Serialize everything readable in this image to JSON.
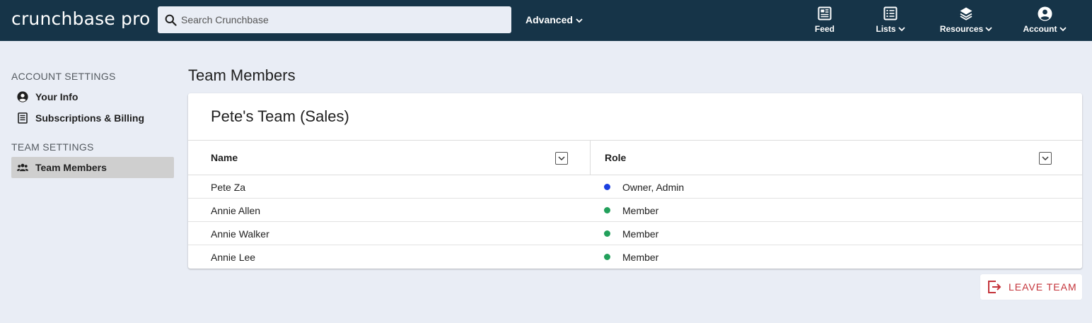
{
  "header": {
    "logo": "crunchbase pro",
    "search_placeholder": "Search Crunchbase",
    "advanced_label": "Advanced",
    "nav": {
      "feed": "Feed",
      "lists": "Lists",
      "resources": "Resources",
      "account": "Account"
    }
  },
  "sidebar": {
    "account_heading": "ACCOUNT SETTINGS",
    "your_info": "Your Info",
    "subscriptions": "Subscriptions & Billing",
    "team_heading": "TEAM SETTINGS",
    "team_members": "Team Members"
  },
  "main": {
    "title": "Team Members",
    "team_name": "Pete's Team (Sales)",
    "columns": {
      "name": "Name",
      "role": "Role"
    },
    "rows": [
      {
        "name": "Pete Za",
        "role": "Owner, Admin",
        "status_color": "#1a3fe0"
      },
      {
        "name": "Annie Allen",
        "role": "Member",
        "status_color": "#22a05b"
      },
      {
        "name": "Annie Walker",
        "role": "Member",
        "status_color": "#22a05b"
      },
      {
        "name": "Annie Lee",
        "role": "Member",
        "status_color": "#22a05b"
      }
    ],
    "leave_label": "LEAVE TEAM"
  },
  "colors": {
    "topbar": "#163448",
    "background": "#e9edf5",
    "danger": "#c4333a",
    "active_nav": "#cfcfcf"
  }
}
